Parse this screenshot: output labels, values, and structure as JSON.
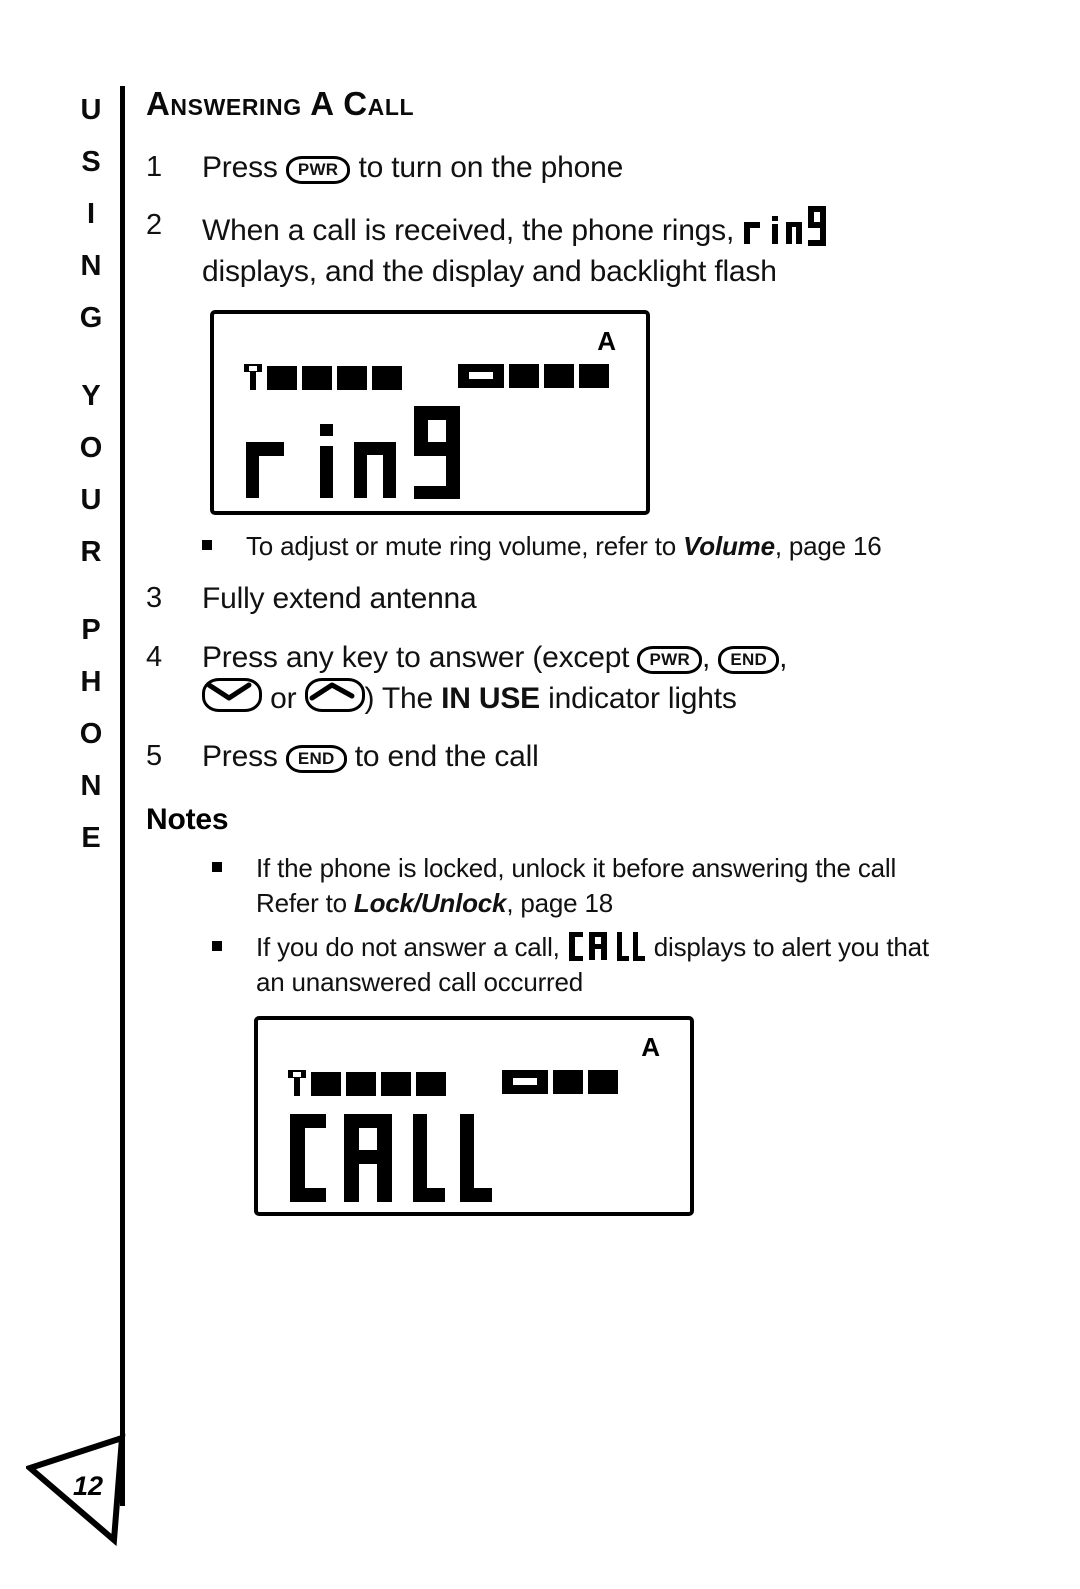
{
  "side_tab": {
    "text": "USING YOUR PHONE",
    "words": [
      "USING",
      "YOUR",
      "PHONE"
    ]
  },
  "page_number": "12",
  "heading": "Answering A Call",
  "steps": [
    {
      "number": "1",
      "parts": [
        {
          "type": "text",
          "value": "Press "
        },
        {
          "type": "key",
          "value": "PWR"
        },
        {
          "type": "text",
          "value": " to turn on the phone"
        }
      ],
      "plain": "Press PWR to turn on the phone"
    },
    {
      "number": "2",
      "plain": "When a call is received, the phone rings, r in9 displays, and the display and backlight flash",
      "line1_before": "When a call is received, the phone rings,",
      "segment": "ring",
      "line2": "displays, and the display and backlight flash"
    },
    {
      "number": "3",
      "plain": "Fully extend antenna"
    },
    {
      "number": "4",
      "plain": "Press any key to answer (except PWR, END, down or up) The IN USE indicator lights",
      "line1_a": "Press any key to answer (except ",
      "key1": "PWR",
      "sep1": ", ",
      "key2": "END",
      "sep2": ",",
      "line2_or": " or ",
      "line2_close": ")  The ",
      "emphasis": "IN USE",
      "line2_end": " indicator lights"
    },
    {
      "number": "5",
      "plain": "Press END to end the call",
      "before": "Press ",
      "key": "END",
      "after": " to end the call"
    }
  ],
  "volume_note": {
    "before": "To adjust or mute ring volume, refer to ",
    "emphasis": "Volume",
    "after": ", page 16"
  },
  "notes_heading": "Notes",
  "notes": [
    {
      "before": "If the phone is locked, unlock it before answering the call  Refer to ",
      "emphasis": "Lock/Unlock",
      "after": ", page 18"
    },
    {
      "before": "If you do not answer a call, ",
      "segment": "CALL",
      "after": " displays to alert you that an unanswered call occurred"
    }
  ],
  "lcd_displays": [
    {
      "name": "ring-display",
      "signal_bars": 4,
      "battery_bars": 4,
      "indicator": "A",
      "text": "ring"
    },
    {
      "name": "call-display",
      "signal_bars": 4,
      "battery_bars": 3,
      "indicator": "A",
      "text": "CALL"
    }
  ],
  "colors": {
    "ink": "#000000",
    "paper": "#ffffff"
  }
}
